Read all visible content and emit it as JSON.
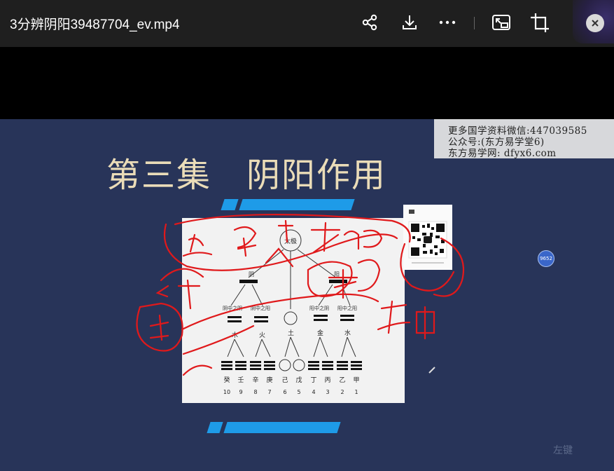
{
  "window": {
    "title": "3分辨阴阳39487704_ev.mp4",
    "toolbar": {
      "share": "share-icon",
      "download": "download-icon",
      "more": "more-icon",
      "picture_in_picture": "picture-in-picture-icon",
      "crop": "crop-icon",
      "close": "close-icon"
    }
  },
  "slide": {
    "title": "第三集　阴阳作用",
    "watermark": {
      "line1": "更多国学资料微信:447039585",
      "line2": "公众号:(东方易学堂6)",
      "line3": "东方易学网: dfyx6.com"
    },
    "diagram": {
      "top": "太极",
      "yin": "阴",
      "yang": "阳",
      "branch_labels": [
        "阴中之阴",
        "阴中之阳",
        "阳中之阴",
        "阳中之阳"
      ],
      "elements": [
        "木",
        "火",
        "土",
        "金",
        "水"
      ],
      "stems": [
        "癸",
        "壬",
        "辛",
        "庚",
        "己",
        "戊",
        "丁",
        "丙",
        "乙",
        "甲"
      ],
      "numbers": [
        "10",
        "9",
        "8",
        "7",
        "6",
        "5",
        "4",
        "3",
        "2",
        "1"
      ]
    },
    "handwriting": [
      "火",
      "木",
      "甲",
      "亥",
      "辛",
      "丁",
      "庚申"
    ],
    "pen_badge": "9652",
    "corner_hint": "左键"
  },
  "colors": {
    "titlebar": "#1f1f1f",
    "slide_bg": "#283459",
    "title_text": "#eadcb8",
    "accent_bar": "#1e9be8",
    "ink": "#e0191b"
  }
}
